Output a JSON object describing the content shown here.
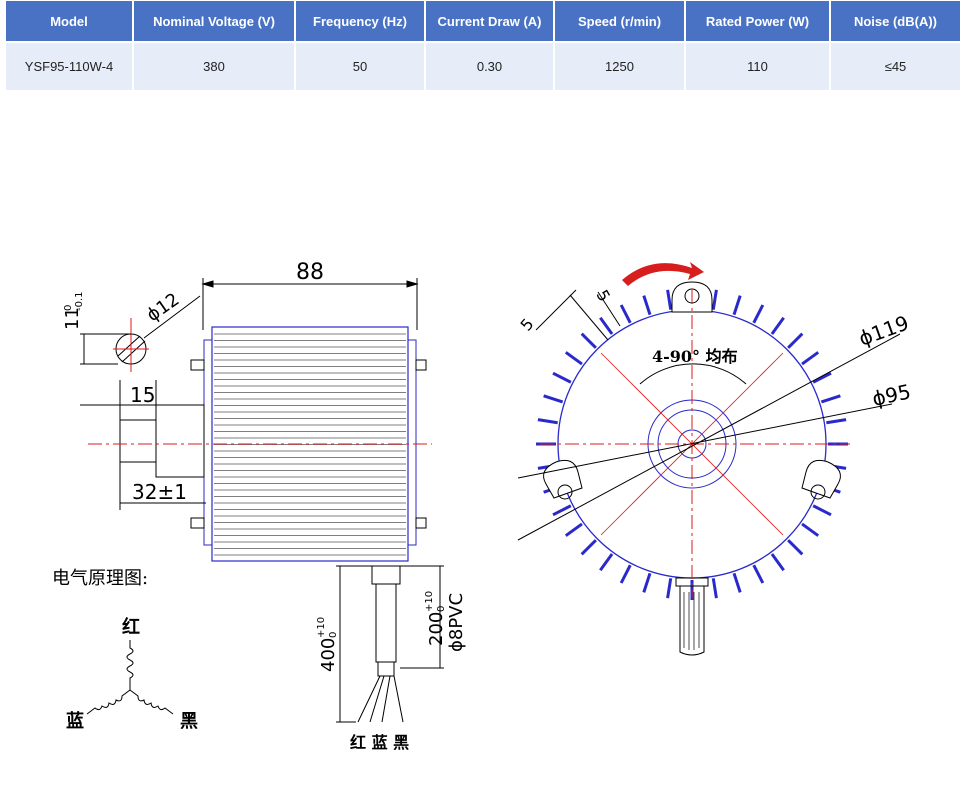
{
  "spec_table": {
    "headers": [
      "Model",
      "Nominal Voltage (V)",
      "Frequency (Hz)",
      "Current Draw (A)",
      "Speed (r/min)",
      "Rated Power (W)",
      "Noise (dB(A))"
    ],
    "row": [
      "YSF95-110W-4",
      "380",
      "50",
      "0.30",
      "1250",
      "110",
      "≤45"
    ]
  },
  "drawing": {
    "dim_width": "88",
    "dim_height_base": "11",
    "dim_height_tol_upper": "0",
    "dim_height_tol_lower": "-0.1",
    "dim_shaft_diameter": "ϕ12",
    "dim_shaft_length": "15",
    "dim_mount": "32±1",
    "dim_lead_400": "400",
    "dim_lead_400_tol": "+10",
    "dim_lead_400_tol_lower": "0",
    "dim_lead_200": "200",
    "dim_lead_200_tol": "+10",
    "dim_lead_200_tol_lower": "0",
    "cable_spec": "ϕ8PVC",
    "wire_colors_bottom": "红 蓝 黑",
    "schematic_title": "电气原理图:",
    "schematic_red": "红",
    "schematic_blue": "蓝",
    "schematic_black": "黑",
    "dim_small_5a": "5",
    "dim_small_5b": "5",
    "mount_holes_note": "4-90°  均布",
    "dim_outer_dia": "ϕ119",
    "dim_inner_dia": "ϕ95"
  },
  "colors": {
    "header_bg": "#4a72c4",
    "row_bg": "#e6ecf8",
    "motor_outline": "#2a2acb",
    "centerline": "#e01818",
    "arrow": "#d81d1d"
  }
}
